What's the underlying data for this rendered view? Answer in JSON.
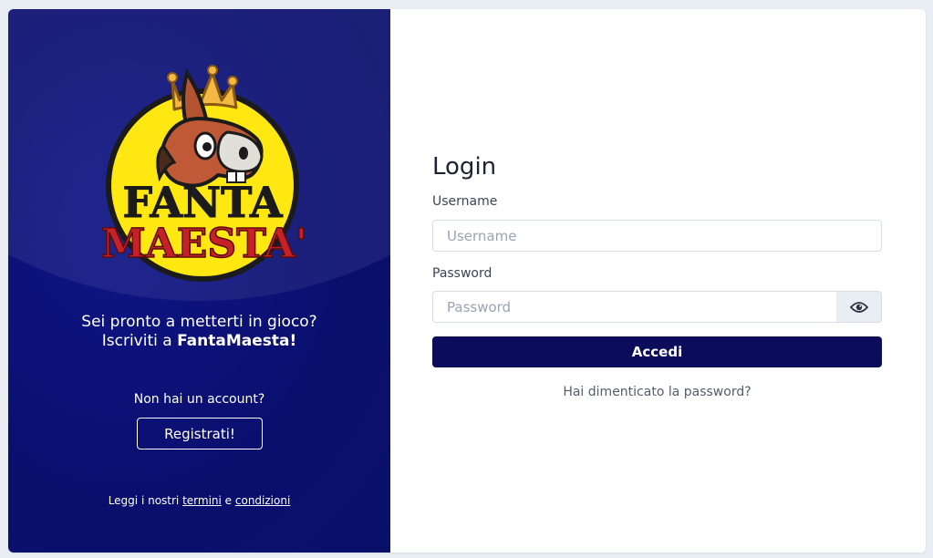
{
  "brand": {
    "logo_text_line1": "FANTA",
    "logo_text_line2": "MAESTA'"
  },
  "left": {
    "tagline_line1": "Sei pronto a metterti in gioco?",
    "tagline_line2_prefix": "Iscriviti a ",
    "tagline_line2_brand": "FantaMaesta!",
    "no_account": "Non hai un account?",
    "register_label": "Registrati!",
    "terms_prefix": "Leggi i nostri ",
    "terms_link": "termini",
    "terms_mid": " e ",
    "conditions_link": "condizioni"
  },
  "login": {
    "title": "Login",
    "username_label": "Username",
    "username_placeholder": "Username",
    "username_value": "",
    "password_label": "Password",
    "password_placeholder": "Password",
    "password_value": "",
    "submit_label": "Accedi",
    "forgot_label": "Hai dimenticato la password?"
  },
  "icons": {
    "password_toggle": "eye-icon"
  },
  "colors": {
    "left_panel_bg": "#0a0f6e",
    "primary_button": "#0b0d5c",
    "logo_yellow": "#ffe812",
    "logo_red": "#c62127"
  }
}
